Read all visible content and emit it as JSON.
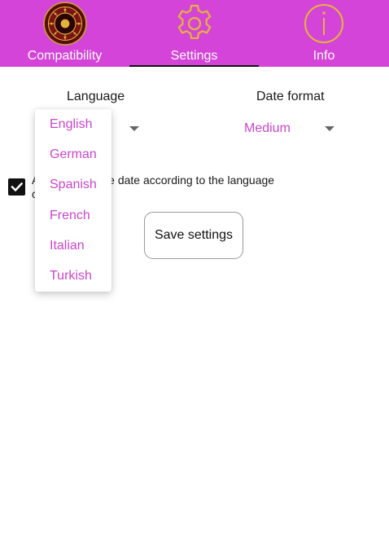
{
  "tabs": [
    {
      "label": "Compatibility",
      "icon": "zodiac-wheel-icon",
      "active": false
    },
    {
      "label": "Settings",
      "icon": "gear-icon",
      "active": true
    },
    {
      "label": "Info",
      "icon": "info-icon",
      "active": false
    }
  ],
  "settings": {
    "language_header": "Language",
    "date_format_header": "Date format",
    "date_format_value": "Medium",
    "checkbox_checked": true,
    "checkbox_text_visible": "A                   the date according to the language\nc",
    "save_label": "Save settings"
  },
  "language_dropdown": {
    "options": [
      "English",
      "German",
      "Spanish",
      "French",
      "Italian",
      "Turkish"
    ]
  },
  "colors": {
    "tab_bar": "#d444d8",
    "accent_text": "#c946cc",
    "icon_gold": "#e2b43a"
  }
}
